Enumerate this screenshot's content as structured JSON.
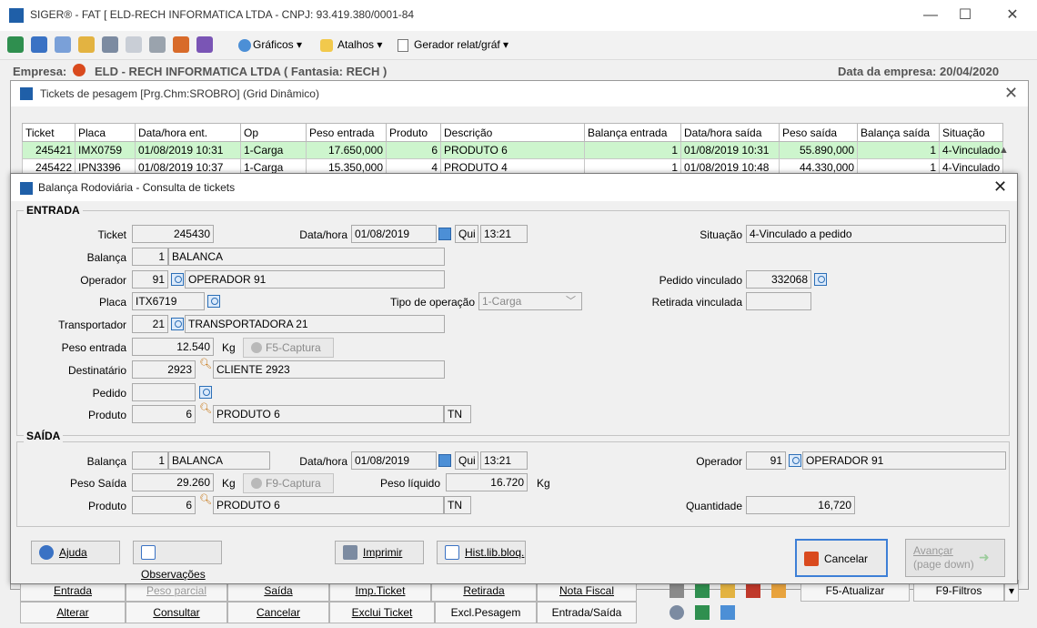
{
  "app": {
    "title": "SIGER® - FAT [ ELD-RECH INFORMATICA LTDA - CNPJ: 93.419.380/0001-84",
    "empresa_label": "Empresa:",
    "empresa_name": "ELD - RECH INFORMATICA LTDA ( Fantasia: RECH )",
    "data_empresa": "Data da empresa: 20/04/2020",
    "toolbar": {
      "graficos": "Gráficos",
      "atalhos": "Atalhos",
      "gerador": "Gerador relat/gráf"
    },
    "controls": {
      "minimize": "—",
      "maximize": "☐",
      "close": "✕"
    }
  },
  "tickets_window": {
    "title": "Tickets de pesagem [Prg.Chm:SROBRO] (Grid Dinâmico)",
    "columns": [
      "Ticket",
      "Placa",
      "Data/hora ent.",
      "Op",
      "Peso entrada",
      "Produto",
      "Descrição",
      "Balança entrada",
      "Data/hora saída",
      "Peso saída",
      "Balança saída",
      "Situação"
    ],
    "rows": [
      [
        "245421",
        "IMX0759",
        "01/08/2019 10:31",
        "1-Carga",
        "17.650,000",
        "6",
        "PRODUTO 6",
        "1",
        "01/08/2019 10:31",
        "55.890,000",
        "1",
        "4-Vinculado"
      ],
      [
        "245422",
        "IPN3396",
        "01/08/2019 10:37",
        "1-Carga",
        "15.350,000",
        "4",
        "PRODUTO 4",
        "1",
        "01/08/2019 10:48",
        "44.330,000",
        "1",
        "4-Vinculado"
      ]
    ],
    "buttons_row1": {
      "entrada": "Entrada",
      "peso_parcial": "Peso parcial",
      "saida": "Saída",
      "imp_ticket": "Imp.Ticket",
      "retirada": "Retirada",
      "nota_fiscal": "Nota Fiscal",
      "f5": "F5-Atualizar",
      "f9": "F9-Filtros"
    },
    "buttons_row2": {
      "alterar": "Alterar",
      "consultar": "Consultar",
      "cancelar": "Cancelar",
      "exclui_ticket": "Exclui Ticket",
      "excl_pesagem": "Excl.Pesagem",
      "entrada_saida": "Entrada/Saída"
    }
  },
  "dialog": {
    "title": "Balança Rodoviária - Consulta de tickets",
    "entrada": {
      "section": "ENTRADA",
      "ticket_label": "Ticket",
      "ticket": "245430",
      "datahora_label": "Data/hora",
      "data": "01/08/2019",
      "dia": "Qui",
      "hora": "13:21",
      "situacao_label": "Situação",
      "situacao": "4-Vinculado a pedido",
      "balanca_label": "Balança",
      "balanca_cod": "1",
      "balanca_nome": "BALANCA",
      "operador_label": "Operador",
      "operador_cod": "91",
      "operador_nome": "OPERADOR 91",
      "pedido_vinc_label": "Pedido vinculado",
      "pedido_vinc": "332068",
      "placa_label": "Placa",
      "placa": "ITX6719",
      "tipo_op_label": "Tipo de operação",
      "tipo_op": "1-Carga",
      "retirada_label": "Retirada vinculada",
      "retirada": "",
      "transp_label": "Transportador",
      "transp_cod": "21",
      "transp_nome": "TRANSPORTADORA 21",
      "peso_label": "Peso entrada",
      "peso": "12.540",
      "kg": "Kg",
      "captura": "F5-Captura",
      "dest_label": "Destinatário",
      "dest_cod": "2923",
      "dest_nome": "CLIENTE 2923",
      "pedido_label": "Pedido",
      "pedido": "",
      "produto_label": "Produto",
      "produto_cod": "6",
      "produto_nome": "PRODUTO 6",
      "unidade": "TN"
    },
    "saida": {
      "section": "SAÍDA",
      "balanca_label": "Balança",
      "balanca_cod": "1",
      "balanca_nome": "BALANCA",
      "datahora_label": "Data/hora",
      "data": "01/08/2019",
      "dia": "Qui",
      "hora": "13:21",
      "operador_label": "Operador",
      "operador_cod": "91",
      "operador_nome": "OPERADOR 91",
      "peso_label": "Peso Saída",
      "peso": "29.260",
      "kg": "Kg",
      "captura": "F9-Captura",
      "liquido_label": "Peso líquido",
      "liquido": "16.720",
      "kg2": "Kg",
      "produto_label": "Produto",
      "produto_cod": "6",
      "produto_nome": "PRODUTO 6",
      "unidade": "TN",
      "qtd_label": "Quantidade",
      "qtd": "16,720"
    },
    "buttons": {
      "ajuda": "Ajuda",
      "observacoes": "Observações",
      "imprimir": "Imprimir",
      "hist": "Hist.lib.bloq.",
      "cancelar": "Cancelar",
      "avancar": "Avançar",
      "avancar_sub": "(page down)"
    }
  }
}
